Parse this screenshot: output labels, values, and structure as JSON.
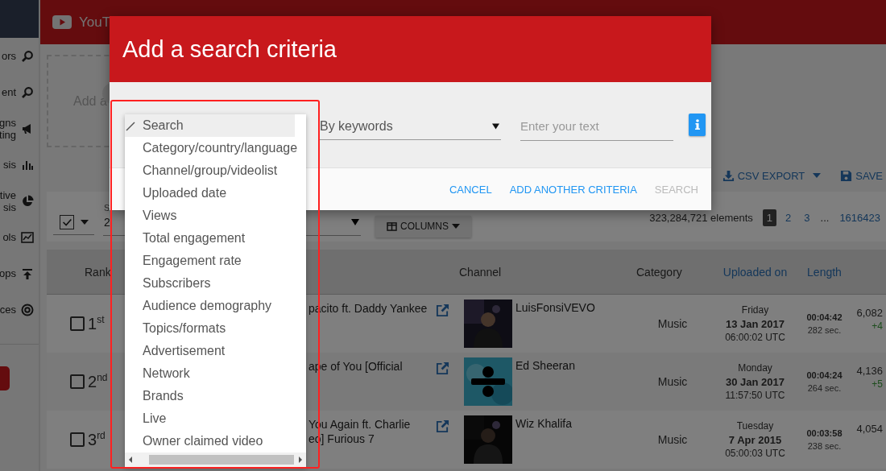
{
  "sidebar": {
    "items": [
      {
        "lines": [
          "ors"
        ]
      },
      {
        "lines": [
          "ent"
        ]
      },
      {
        "lines": [
          "gns",
          "ting"
        ]
      },
      {
        "lines": [
          "sis"
        ]
      },
      {
        "lines": [
          "tive",
          "sis"
        ]
      },
      {
        "lines": [
          "ols"
        ]
      },
      {
        "lines": [
          "ops"
        ]
      },
      {
        "lines": [
          "ces"
        ]
      }
    ]
  },
  "top_bar": {
    "brand": "YouT"
  },
  "add_panel": {
    "label": "Add a"
  },
  "toolbar": {
    "csv_export": "CSV EXPORT",
    "save": "SAVE"
  },
  "list_controls": {
    "select_all_checked": true,
    "rows_label": "S",
    "rows_value": "2",
    "columns_button": "COLUMNS",
    "count": "323,284,721 elements",
    "pages": [
      {
        "kind": "page",
        "label": "1",
        "selected": true
      },
      {
        "kind": "page",
        "label": "2",
        "selected": false
      },
      {
        "kind": "page",
        "label": "3",
        "selected": false
      },
      {
        "kind": "gap",
        "label": "...",
        "selected": false
      },
      {
        "kind": "page",
        "label": "1616423",
        "selected": false
      }
    ]
  },
  "table": {
    "columns": [
      {
        "label": "Rank",
        "sortable": false
      },
      {
        "label": "Channel",
        "sortable": false
      },
      {
        "label": "Category",
        "sortable": false
      },
      {
        "label": "Uploaded on",
        "sortable": true
      },
      {
        "label": "Length",
        "sortable": true
      }
    ],
    "rows": [
      {
        "checked": false,
        "rank": "1$^{st}$",
        "title_lines": [
          "pacito ft. Daddy Yankee"
        ],
        "channel": "LuisFonsiVEVO",
        "category": "Music",
        "day": "Friday",
        "date": "13 Jan 2017",
        "time": "06:00:02 UTC",
        "length": "00:04:42",
        "seconds": "282 sec.",
        "views": "6,082",
        "views_change": "+4"
      },
      {
        "checked": false,
        "rank": "2$^{nd}$",
        "title_lines": [
          "ape of You [Official"
        ],
        "channel": "Ed Sheeran",
        "category": "Music",
        "day": "Monday",
        "date": "30 Jan 2017",
        "time": "11:57:50 UTC",
        "length": "00:04:24",
        "seconds": "264 sec.",
        "views": "4,136",
        "views_change": "+5"
      },
      {
        "checked": false,
        "rank": "3$^{rd}$",
        "title_lines": [
          "You Again ft. Charlie",
          "eo] Furious 7"
        ],
        "channel": "Wiz Khalifa",
        "category": "Music",
        "day": "Tuesday",
        "date": "7 Apr 2015",
        "time": "05:00:03 UTC",
        "length": "00:03:58",
        "seconds": "238 sec.",
        "views": "4,054"
      }
    ]
  },
  "dialog": {
    "title": "Add a search criteria",
    "match_select": {
      "value": "By keywords"
    },
    "text_input": {
      "placeholder": "Enter your text"
    },
    "buttons": [
      {
        "label": "CANCEL",
        "disabled": false
      },
      {
        "label": "ADD ANOTHER CRITERIA",
        "disabled": false
      },
      {
        "label": "SEARCH",
        "disabled": true
      }
    ]
  },
  "criteria_dropdown": {
    "options": [
      {
        "label": "Search",
        "selected": true
      },
      {
        "label": "Category/country/language",
        "selected": false
      },
      {
        "label": "Channel/group/videolist",
        "selected": false
      },
      {
        "label": "Uploaded date",
        "selected": false
      },
      {
        "label": "Views",
        "selected": false
      },
      {
        "label": "Total engagement",
        "selected": false
      },
      {
        "label": "Engagement rate",
        "selected": false
      },
      {
        "label": "Subscribers",
        "selected": false
      },
      {
        "label": "Audience demography",
        "selected": false
      },
      {
        "label": "Topics/formats",
        "selected": false
      },
      {
        "label": "Advertisement",
        "selected": false
      },
      {
        "label": "Network",
        "selected": false
      },
      {
        "label": "Brands",
        "selected": false
      },
      {
        "label": "Live",
        "selected": false
      },
      {
        "label": "Owner claimed video",
        "selected": false
      }
    ]
  }
}
